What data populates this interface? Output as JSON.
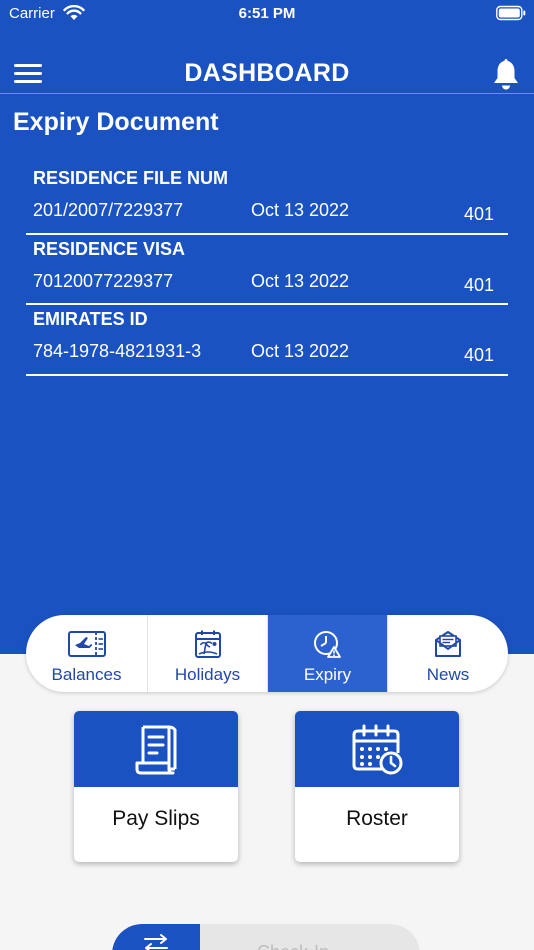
{
  "status": {
    "carrier": "Carrier",
    "time": "6:51 PM"
  },
  "header": {
    "title": "DASHBOARD"
  },
  "section": {
    "title": "Expiry Document"
  },
  "documents": [
    {
      "name": "RESIDENCE FILE NUM",
      "number": "201/2007/7229377",
      "date": "Oct 13 2022",
      "count": "401"
    },
    {
      "name": "RESIDENCE VISA",
      "number": "70120077229377",
      "date": "Oct 13 2022",
      "count": "401"
    },
    {
      "name": "EMIRATES ID",
      "number": "784-1978-4821931-3",
      "date": "Oct 13 2022",
      "count": "401"
    }
  ],
  "tabs": [
    {
      "label": "Balances",
      "icon": "ticket-icon",
      "active": false
    },
    {
      "label": "Holidays",
      "icon": "holiday-calendar-icon",
      "active": false
    },
    {
      "label": "Expiry",
      "icon": "clock-warning-icon",
      "active": true
    },
    {
      "label": "News",
      "icon": "envelope-icon",
      "active": false
    }
  ],
  "cards": {
    "payslips": {
      "label": "Pay Slips",
      "icon": "receipt-icon"
    },
    "roster": {
      "label": "Roster",
      "icon": "calendar-clock-icon"
    }
  },
  "bottom": {
    "toggle_text": "Check-In",
    "icon": "swap-arrows-icon"
  },
  "colors": {
    "primary": "#1a52c2",
    "active_tab": "#2b62d0",
    "tab_text": "#2148a8",
    "background": "#f5f5f5"
  }
}
